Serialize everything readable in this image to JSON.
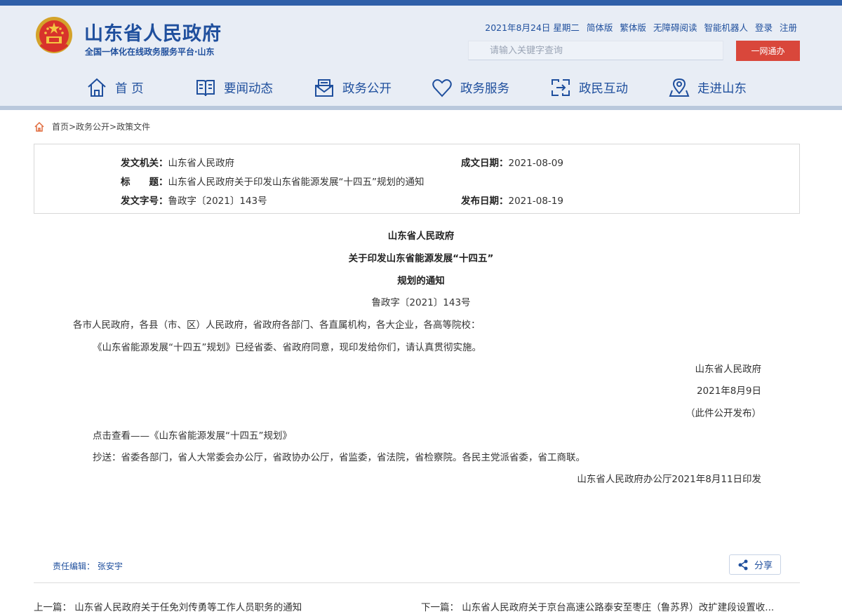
{
  "header": {
    "title": "山东省人民政府",
    "subtitle": "全国一体化在线政务服务平台·山东",
    "top_links": [
      "2021年8月24日 星期二",
      "简体版",
      "繁体版",
      "无障碍阅读",
      "智能机器人",
      "登录",
      "注册"
    ],
    "search_placeholder": "请输入关键字查询",
    "search_button": "一网通办"
  },
  "nav": [
    {
      "label": "首 页",
      "icon": "home-icon"
    },
    {
      "label": "要闻动态",
      "icon": "book-icon"
    },
    {
      "label": "政务公开",
      "icon": "mail-icon"
    },
    {
      "label": "政务服务",
      "icon": "heart-icon"
    },
    {
      "label": "政民互动",
      "icon": "interaction-icon"
    },
    {
      "label": "走进山东",
      "icon": "location-icon"
    }
  ],
  "breadcrumb": "首页>政务公开>政策文件",
  "meta": {
    "issuer_label": "发文机关：",
    "issuer": "山东省人民政府",
    "written_date_label": "成文日期：",
    "written_date": "2021-08-09",
    "title_label": "标　　题：",
    "title": "山东省人民政府关于印发山东省能源发展“十四五”规划的通知",
    "doc_no_label": "发文字号：",
    "doc_no": "鲁政字〔2021〕143号",
    "publish_date_label": "发布日期：",
    "publish_date": "2021-08-19"
  },
  "document": {
    "heading1": "山东省人民政府",
    "heading2": "关于印发山东省能源发展“十四五”",
    "heading3": "规划的通知",
    "doc_no": "鲁政字〔2021〕143号",
    "salutation": "各市人民政府，各县（市、区）人民政府，省政府各部门、各直属机构，各大企业，各高等院校：",
    "body": "《山东省能源发展“十四五”规划》已经省委、省政府同意，现印发给你们，请认真贯彻实施。",
    "sign_org": "山东省人民政府",
    "sign_date": "2021年8月9日",
    "publish_note": "（此件公开发布）",
    "link_text": "点击查看——《山东省能源发展“十四五”规划》",
    "cc": "抄送：省委各部门，省人大常委会办公厅，省政协办公厅，省监委，省法院，省检察院。各民主党派省委，省工商联。",
    "printed_by": "山东省人民政府办公厅2021年8月11日印发"
  },
  "footer": {
    "editor": "责任编辑： 张安宇",
    "share": "分享",
    "prev": "上一篇： 山东省人民政府关于任免刘传勇等工作人员职务的通知",
    "next": "下一篇： 山东省人民政府关于京台高速公路泰安至枣庄（鲁苏界）改扩建段设置收..."
  },
  "colors": {
    "brand_blue": "#1f4f9d",
    "header_bg": "#e8edf5",
    "accent_red": "#d9473b"
  }
}
